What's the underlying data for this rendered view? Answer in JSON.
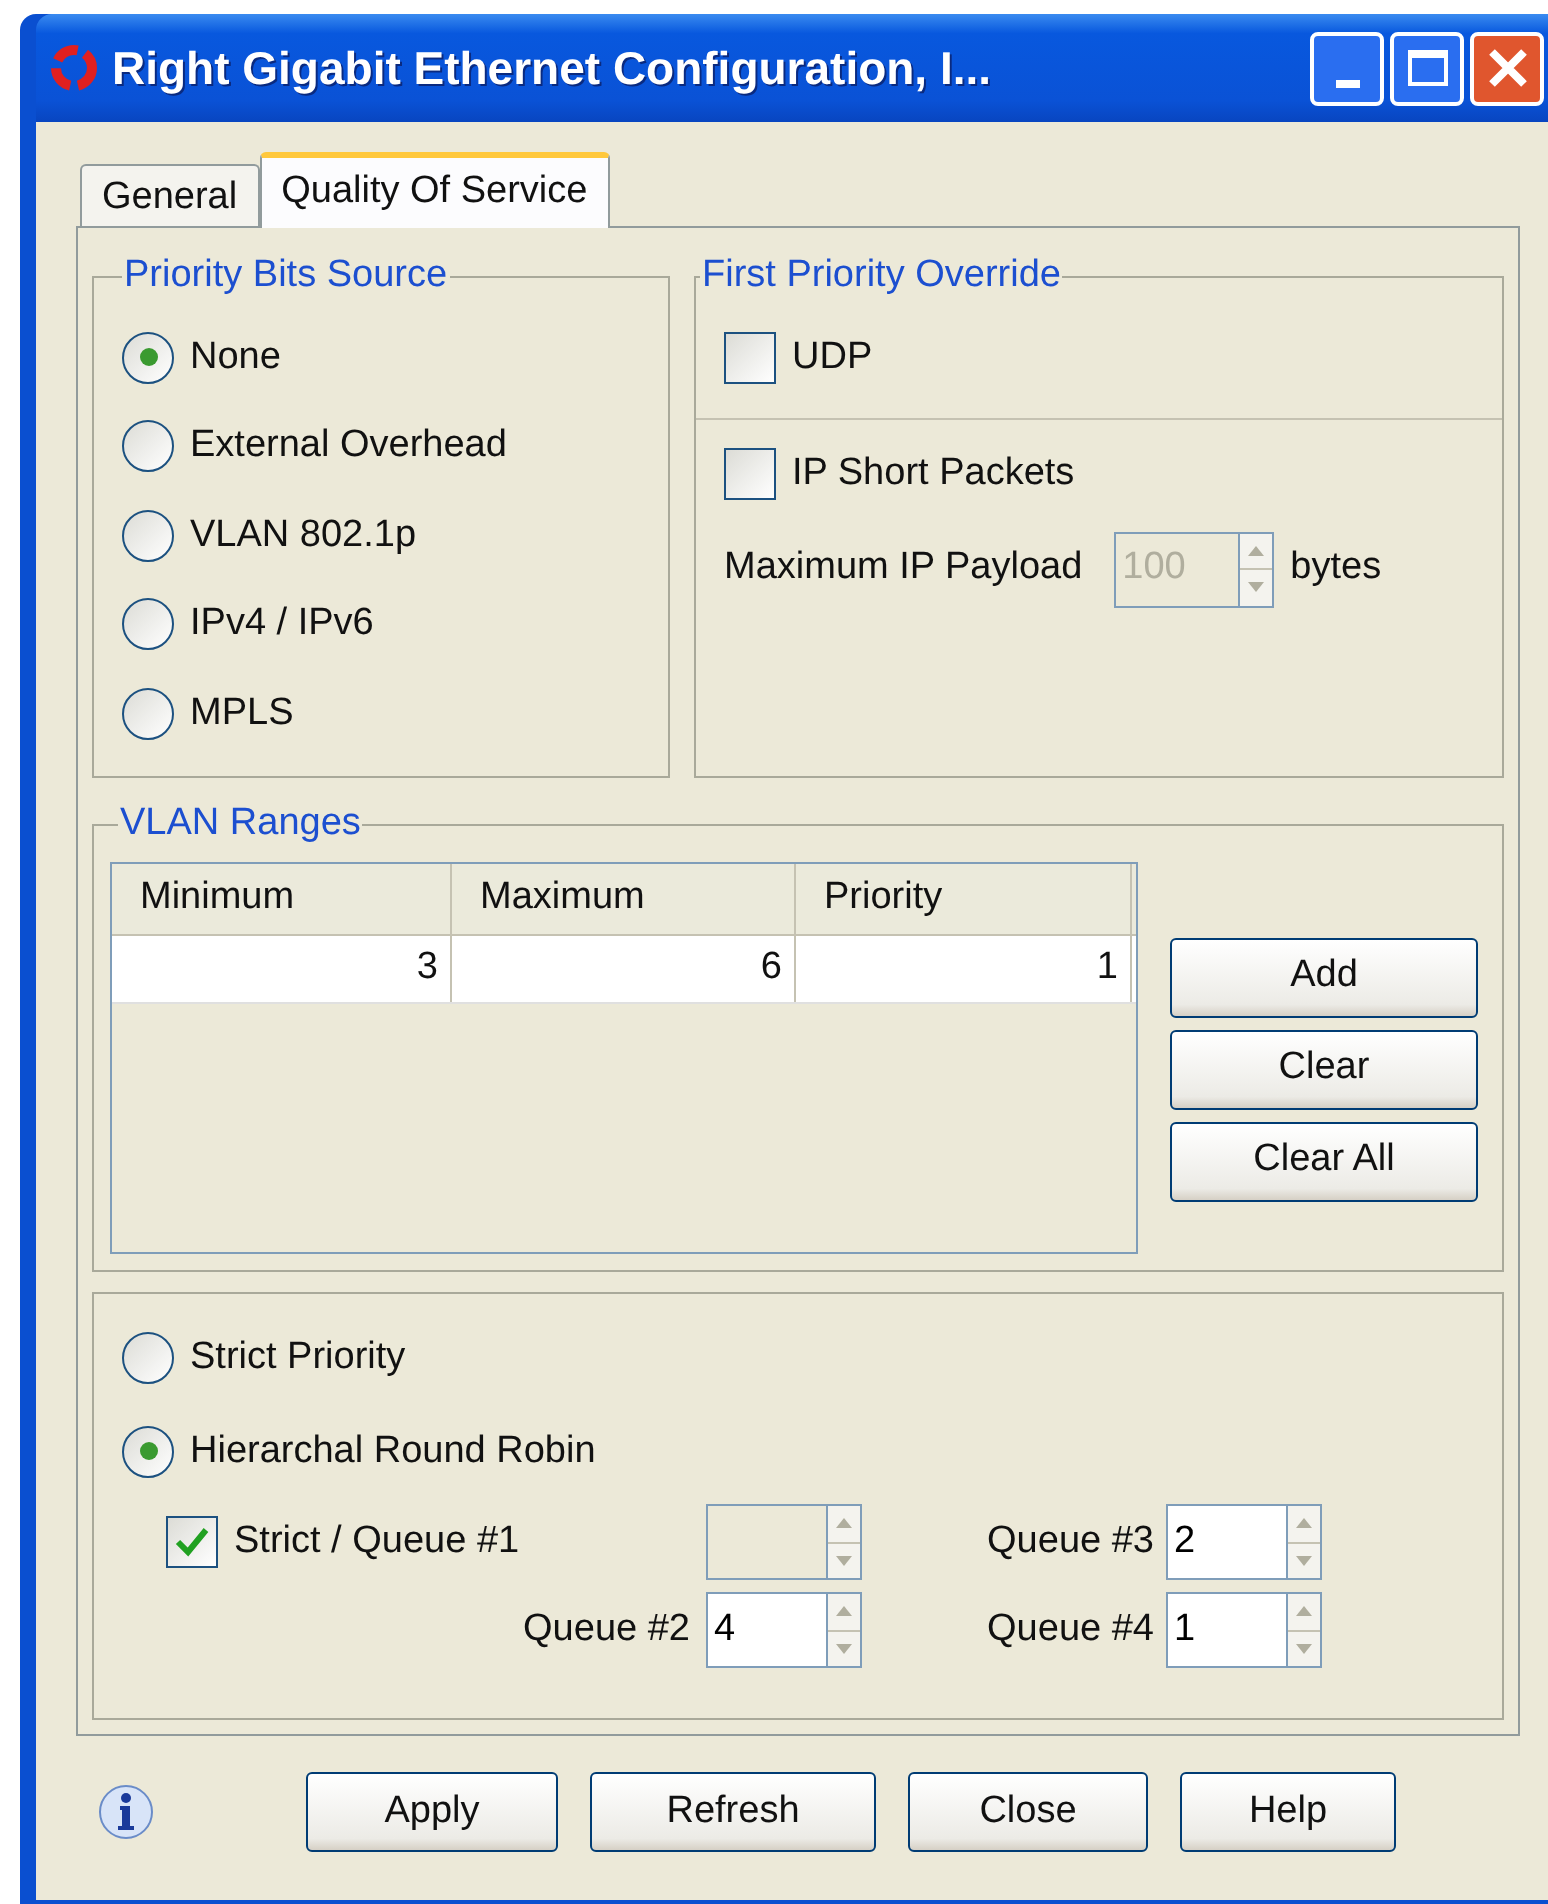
{
  "window": {
    "title": "Right Gigabit Ethernet Configuration, I..."
  },
  "tabs": [
    {
      "label": "General",
      "selected": false
    },
    {
      "label": "Quality Of Service",
      "selected": true
    }
  ],
  "priority_bits_source": {
    "title": "Priority Bits Source",
    "options": [
      {
        "label": "None",
        "selected": true
      },
      {
        "label": "External Overhead",
        "selected": false
      },
      {
        "label": "VLAN 802.1p",
        "selected": false
      },
      {
        "label": "IPv4 / IPv6",
        "selected": false
      },
      {
        "label": "MPLS",
        "selected": false
      }
    ]
  },
  "first_priority_override": {
    "title": "First Priority Override",
    "udp": {
      "label": "UDP",
      "checked": false
    },
    "ip_short_packets": {
      "label": "IP Short Packets",
      "checked": false
    },
    "max_payload": {
      "label": "Maximum IP Payload",
      "value": "100",
      "unit": "bytes",
      "disabled": true
    }
  },
  "vlan_ranges": {
    "title": "VLAN Ranges",
    "columns": [
      "Minimum",
      "Maximum",
      "Priority"
    ],
    "rows": [
      [
        "3",
        "6",
        "1"
      ]
    ],
    "buttons": [
      "Add",
      "Clear",
      "Clear All"
    ]
  },
  "scheduling": {
    "options": [
      {
        "label": "Strict Priority",
        "selected": false
      },
      {
        "label": "Hierarchal Round Robin",
        "selected": true
      }
    ],
    "queues": [
      {
        "kind": "checkbox",
        "label": "Strict / Queue #1",
        "checked": true,
        "disabled": true
      },
      {
        "kind": "plain",
        "label": "Queue #3",
        "value": "2",
        "disabled": false
      },
      {
        "kind": "plain",
        "label": "Queue #2",
        "value": "4",
        "disabled": false
      },
      {
        "kind": "plain",
        "label": "Queue #4",
        "value": "1",
        "disabled": false
      }
    ]
  },
  "buttons": [
    "Apply",
    "Refresh",
    "Close",
    "Help"
  ]
}
